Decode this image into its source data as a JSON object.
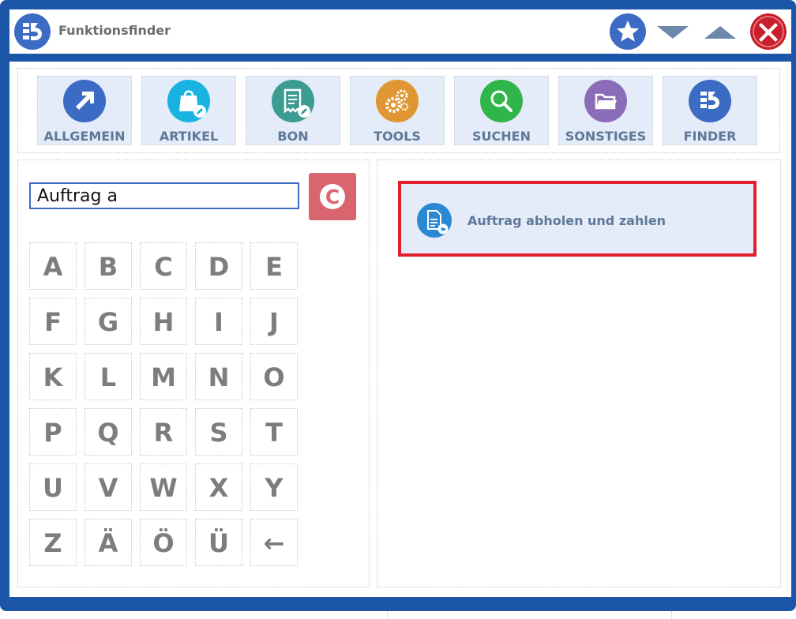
{
  "window": {
    "title": "Funktionsfinder",
    "buttons": [
      {
        "name": "favorite-button",
        "icon": "star-icon"
      },
      {
        "name": "minimize-button",
        "icon": "chevron-down-icon"
      },
      {
        "name": "maximize-button",
        "icon": "chevron-up-icon"
      },
      {
        "name": "close-button",
        "icon": "close-icon"
      }
    ]
  },
  "tabs": [
    {
      "label": "ALLGEMEIN",
      "icon": "arrow-up-right-icon",
      "color": "#3c6bc4"
    },
    {
      "label": "ARTIKEL",
      "icon": "shopping-bag-icon",
      "color": "#18b3e0"
    },
    {
      "label": "BON",
      "icon": "receipt-icon",
      "color": "#3b9c92"
    },
    {
      "label": "TOOLS",
      "icon": "gears-icon",
      "color": "#e09632"
    },
    {
      "label": "SUCHEN",
      "icon": "search-icon",
      "color": "#30b54a"
    },
    {
      "label": "SONSTIGES",
      "icon": "folder-icon",
      "color": "#8a6cb8"
    },
    {
      "label": "FINDER",
      "icon": "finder-logo-icon",
      "color": "#3c6bc4"
    }
  ],
  "search": {
    "value": "Auftrag a",
    "clear_label": "C"
  },
  "keyboard": {
    "keys": [
      "A",
      "B",
      "C",
      "D",
      "E",
      "F",
      "G",
      "H",
      "I",
      "J",
      "K",
      "L",
      "M",
      "N",
      "O",
      "P",
      "Q",
      "R",
      "S",
      "T",
      "U",
      "V",
      "W",
      "X",
      "Y",
      "Z",
      "Ä",
      "Ö",
      "Ü",
      "←"
    ]
  },
  "results": [
    {
      "label": "Auftrag abholen und zahlen",
      "icon": "document-pickup-icon",
      "selected": true
    }
  ],
  "colors": {
    "frame": "#1b56a8",
    "accent": "#3c6bc4",
    "selection": "#e3202c",
    "tile": "#e3ecf8",
    "clear": "#d9666e"
  }
}
